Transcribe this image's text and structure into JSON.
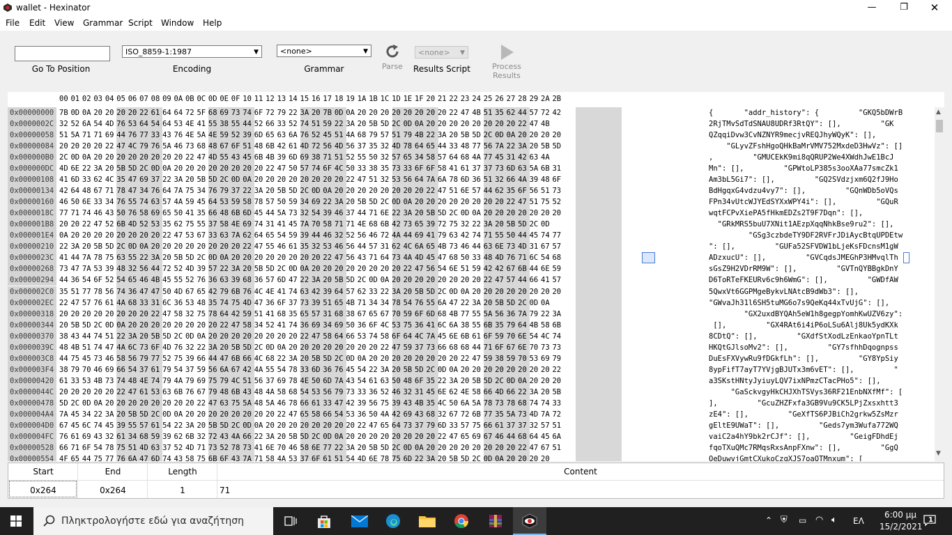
{
  "window": {
    "title": "wallet - Hexinator",
    "controls": {
      "minimize": "—",
      "maximize": "❐",
      "close": "✕"
    }
  },
  "menu": [
    "File",
    "Edit",
    "View",
    "Grammar",
    "Script",
    "Window",
    "Help"
  ],
  "toolbar": {
    "goto_value": "",
    "goto_label": "Go To Position",
    "encoding_value": "ISO_8859-1:1987",
    "encoding_label": "Encoding",
    "grammar_value": "<none>",
    "grammar_label": "Grammar",
    "parse_label": "Parse",
    "results_script_value": "<none>",
    "results_script_label": "Results Script",
    "process_results_label": "Process Results"
  },
  "hex_view": {
    "column_headers": [
      "00",
      "01",
      "02",
      "03",
      "04",
      "05",
      "06",
      "07",
      "08",
      "09",
      "0A",
      "0B",
      "0C",
      "0D",
      "0E",
      "0F",
      "10",
      "11",
      "12",
      "13",
      "14",
      "15",
      "16",
      "17",
      "18",
      "19",
      "1A",
      "1B",
      "1C",
      "1D",
      "1E",
      "1F",
      "20",
      "21",
      "22",
      "23",
      "24",
      "25",
      "26",
      "27",
      "28",
      "29",
      "2A",
      "2B"
    ],
    "selected": {
      "row": 13,
      "col": 40,
      "ascii_char": "q"
    },
    "rows": [
      {
        "offset": "0x00000000",
        "bytes": "7B 0D 0A 20 20 20 20 22 61 64 64 72 5F 68 69 73 74 6F 72 79 22 3A 20 7B 0D 0A 20 20 20 20 20 20 20 20 22 47 4B 51 35 62 44 57 72 42",
        "ascii": "{       \"addr_history\": {         \"GKQ5bDWrB"
      },
      {
        "offset": "0x0000002C",
        "bytes": "32 52 6A 54 4D 76 53 64 54 64 53 4E 41 55 38 55 44 52 66 33 52 74 51 59 22 3A 20 5B 5D 2C 0D 0A 20 20 20 20 20 20 20 20 22 47 4B",
        "ascii": "2RjTMvSdTdSNAU8UDRf3RtQY\": [],         \"GK"
      },
      {
        "offset": "0x00000058",
        "bytes": "51 5A 71 71 69 44 76 77 33 43 76 4E 5A 4E 59 52 39 6D 65 63 6A 76 52 45 51 4A 68 79 57 51 79 4B 22 3A 20 5B 5D 2C 0D 0A 20 20 20 20",
        "ascii": "QZqqiDvw3CvNZNYR9mecjvREQJhyWQyK\": [],"
      },
      {
        "offset": "0x00000084",
        "bytes": "20 20 20 20 22 47 4C 79 76 5A 46 73 68 48 67 6F 51 48 6B 42 61 4D 72 56 4D 56 37 35 32 4D 78 64 65 44 33 48 77 56 7A 22 3A 20 5B 5D",
        "ascii": "    \"GLyvZFshHgoQHkBaMrVMV752MxdeD3HwVz\": []"
      },
      {
        "offset": "0x000000B0",
        "bytes": "2C 0D 0A 20 20 20 20 20 20 20 20 22 47 4D 55 43 45 6B 4B 39 6D 69 38 71 51 52 55 50 32 57 65 34 58 57 64 68 4A 77 45 31 42 63 4A",
        "ascii": ",         \"GMUCEkK9mi8qQRUP2We4XWdhJwE1BcJ"
      },
      {
        "offset": "0x000000DC",
        "bytes": "4D 6E 22 3A 20 5B 5D 2C 0D 0A 20 20 20 20 20 20 20 20 22 47 50 57 74 6F 4C 50 33 38 35 73 33 6F 6F 58 41 61 37 37 73 6D 63 5A 6B 31",
        "ascii": "Mn\": [],         \"GPWtoLP385s3ooXAa77smcZk1"
      },
      {
        "offset": "0x00000108",
        "bytes": "41 6D 33 62 4C 35 47 69 37 22 3A 20 5B 5D 2C 0D 0A 20 20 20 20 20 20 20 20 22 47 51 32 53 56 64 7A 6A 78 6D 36 51 32 66 4A 39 48 6F",
        "ascii": "Am3bL5Gi7\": [],         \"GQ2SVdzjxm6Q2fJ9Ho"
      },
      {
        "offset": "0x00000134",
        "bytes": "42 64 48 67 71 78 47 34 76 64 7A 75 34 76 79 37 22 3A 20 5B 5D 2C 0D 0A 20 20 20 20 20 20 20 20 22 47 51 6E 57 44 62 35 6F 56 51 73",
        "ascii": "BdHgqxG4vdzu4vy7\": [],         \"GQnWDb5oVQs"
      },
      {
        "offset": "0x00000160",
        "bytes": "46 50 6E 33 34 76 55 74 63 57 4A 59 45 64 53 59 58 78 57 50 59 34 69 22 3A 20 5B 5D 2C 0D 0A 20 20 20 20 20 20 20 20 22 47 51 75 52",
        "ascii": "FPn34vUtcWJYEdSYXxWPY4i\": [],         \"GQuR"
      },
      {
        "offset": "0x0000018C",
        "bytes": "77 71 74 46 43 50 76 58 69 65 50 41 35 66 48 6B 6D 45 44 5A 73 32 54 39 46 37 44 71 6E 22 3A 20 5B 5D 2C 0D 0A 20 20 20 20 20 20 20",
        "ascii": "wqtFCPvXiePA5fHkmEDZs2T9F7Dqn\": [],"
      },
      {
        "offset": "0x000001B8",
        "bytes": "20 20 22 47 52 6B 4D 52 53 35 62 75 55 37 58 4E 69 74 31 41 45 7A 70 58 71 71 4E 68 6B 42 73 65 39 72 75 32 22 3A 20 5B 5D 2C 0D",
        "ascii": "  \"GRkMRS5buU7XNit1AEzpXqqNhkBse9ru2\": [],"
      },
      {
        "offset": "0x000001E4",
        "bytes": "0A 20 20 20 20 20 20 20 20 22 47 53 67 33 63 7A 62 64 65 54 59 39 44 46 32 52 56 46 72 4A 44 69 41 79 63 42 74 71 55 50 44 45 74 77",
        "ascii": "         \"GSg3czbdeTY9DF2RVFrJDiAycBtqUPDEtw"
      },
      {
        "offset": "0x00000210",
        "bytes": "22 3A 20 5B 5D 2C 0D 0A 20 20 20 20 20 20 20 20 22 47 55 46 61 35 32 53 46 56 44 57 31 62 4C 6A 65 4B 73 46 44 63 6E 73 4D 31 67 57",
        "ascii": "\": [],         \"GUFa52SFVDW1bLjeKsFDcnsM1gW"
      },
      {
        "offset": "0x0000023C",
        "bytes": "41 44 7A 78 75 63 55 22 3A 20 5B 5D 2C 0D 0A 20 20 20 20 20 20 20 20 22 47 56 43 71 64 73 4A 4D 45 47 68 50 33 48 4D 76 71 6C 54 68",
        "ascii": "ADzxucU\": [],         \"GVCqdsJMEGhP3HMvqlTh"
      },
      {
        "offset": "0x00000268",
        "bytes": "73 47 7A 53 39 48 32 56 44 72 52 4D 39 57 22 3A 20 5B 5D 2C 0D 0A 20 20 20 20 20 20 20 20 22 47 56 54 6E 51 59 42 42 67 6B 44 6E 59",
        "ascii": "sGsZ9H2VDrRM9W\": [],         \"GVTnQYBBgkDnY"
      },
      {
        "offset": "0x00000294",
        "bytes": "44 36 54 6F 52 54 65 46 4B 45 55 52 76 36 63 39 68 36 57 6D 47 22 3A 20 5B 5D 2C 0D 0A 20 20 20 20 20 20 20 20 22 47 57 44 66 41 57",
        "ascii": "D6ToRTeFKEURv6c9h6WmG\": [],         \"GWDfAW"
      },
      {
        "offset": "0x000002C0",
        "bytes": "35 51 77 78 56 74 36 47 47 50 4D 67 65 42 79 6B 76 4C 4E 41 74 63 42 39 64 57 62 33 22 3A 20 5B 5D 2C 0D 0A 20 20 20 20 20 20 20 20",
        "ascii": "5QwxVt6GGPMgeBykvLNAtcB9dWb3\": [],"
      },
      {
        "offset": "0x000002EC",
        "bytes": "22 47 57 76 61 4A 68 33 31 6C 36 53 48 35 74 75 4D 47 36 6F 37 73 39 51 65 4B 71 34 34 78 54 76 55 6A 47 22 3A 20 5B 5D 2C 0D 0A",
        "ascii": "\"GWvaJh31l6SH5tuMG6o7s9QeKq44xTvUjG\": [],"
      },
      {
        "offset": "0x00000318",
        "bytes": "20 20 20 20 20 20 20 20 22 47 58 32 75 78 64 42 59 51 41 68 35 65 57 31 68 38 67 65 67 70 59 6F 6D 68 4B 77 55 5A 56 36 7A 79 22 3A",
        "ascii": "        \"GX2uxdBYQAh5eW1h8gegpYomhKwUZV6zy\":"
      },
      {
        "offset": "0x00000344",
        "bytes": "20 5B 5D 2C 0D 0A 20 20 20 20 20 20 20 20 22 47 58 34 52 41 74 36 69 34 69 50 36 6F 4C 53 75 36 41 6C 6A 38 55 6B 35 79 64 4B 58 6B",
        "ascii": " [],         \"GX4RAt6i4iP6oLSu6Alj8Uk5ydKXk"
      },
      {
        "offset": "0x00000370",
        "bytes": "38 43 44 74 51 22 3A 20 5B 5D 2C 0D 0A 20 20 20 20 20 20 20 20 22 47 58 64 66 53 74 58 6F 64 4C 7A 45 6E 6B 61 6F 59 70 6E 54 4C 74",
        "ascii": "8CDtQ\": [],         \"GXdfStXodLzEnkaoYpnTLt"
      },
      {
        "offset": "0x0000039C",
        "bytes": "48 4B 51 74 47 4A 6C 73 6F 4D 76 32 22 3A 20 5B 5D 2C 0D 0A 20 20 20 20 20 20 20 20 22 47 59 37 73 66 68 68 44 71 6F 67 6E 70 73 73",
        "ascii": "HKQtGJlsoMv2\": [],         \"GY7sfhhDqognpss"
      },
      {
        "offset": "0x000003C8",
        "bytes": "44 75 45 73 46 58 56 79 77 52 75 39 66 44 47 6B 66 4C 68 22 3A 20 5B 5D 2C 0D 0A 20 20 20 20 20 20 20 20 22 47 59 38 59 70 53 69 79",
        "ascii": "DuEsFXVywRu9fDGkfLh\": [],         \"GY8YpSiy"
      },
      {
        "offset": "0x000003F4",
        "bytes": "38 79 70 46 69 66 54 37 61 79 54 37 59 56 6A 67 42 4A 55 54 78 33 6D 36 76 45 54 22 3A 20 5B 5D 2C 0D 0A 20 20 20 20 20 20 20 20 22",
        "ascii": "8ypFifT7ayT7YVjgBJUTx3m6vET\": [],         \""
      },
      {
        "offset": "0x00000420",
        "bytes": "61 33 53 4B 73 74 48 4E 74 79 4A 79 69 75 79 4C 51 56 37 69 78 4E 50 6D 7A 43 54 61 63 50 48 6F 35 22 3A 20 5B 5D 2C 0D 0A 20 20 20",
        "ascii": "a3SKstHNtyJyiuyLQV7ixNPmzCTacPHo5\": [],"
      },
      {
        "offset": "0x0000044C",
        "bytes": "20 20 20 20 20 22 47 61 53 63 6B 76 67 79 48 6B 43 48 4A 58 68 54 53 56 79 73 33 36 52 46 32 31 45 6E 62 4E 58 66 4D 66 22 3A 20 5B",
        "ascii": "     \"GaSckvgyHkCHJXhTSVys36RF21EnbNXfMf\": ["
      },
      {
        "offset": "0x00000478",
        "bytes": "5D 2C 0D 0A 20 20 20 20 20 20 20 20 22 47 63 75 5A 48 5A 46 78 66 61 33 47 42 39 56 75 39 43 4B 35 4C 50 6A 5A 78 73 78 68 74 74 33",
        "ascii": "],         \"GcuZHZFxfa3GB9Vu9CK5LPjZxsxhtt3"
      },
      {
        "offset": "0x000004A4",
        "bytes": "7A 45 34 22 3A 20 5B 5D 2C 0D 0A 20 20 20 20 20 20 20 20 22 47 65 58 66 54 53 36 50 4A 42 69 43 68 32 67 72 6B 77 35 5A 73 4D 7A 72",
        "ascii": "zE4\": [],         \"GeXfTS6PJBiCh2grkw5ZsMzr"
      },
      {
        "offset": "0x000004D0",
        "bytes": "67 45 6C 74 45 39 55 57 61 54 22 3A 20 5B 5D 2C 0D 0A 20 20 20 20 20 20 20 20 22 47 65 64 73 37 79 6D 33 57 75 66 61 37 37 32 57 51",
        "ascii": "gEltE9UWaT\": [],         \"Geds7ym3Wufa772WQ"
      },
      {
        "offset": "0x000004FC",
        "bytes": "76 61 69 43 32 61 34 68 59 39 62 6B 32 72 43 4A 66 22 3A 20 5B 5D 2C 0D 0A 20 20 20 20 20 20 20 20 22 47 65 69 67 46 44 68 64 45 6A",
        "ascii": "vaiC2a4hY9bk2rCJf\": [],         \"GeigFDhdEj"
      },
      {
        "offset": "0x00000528",
        "bytes": "66 71 6F 54 78 75 51 4D 63 37 52 4D 71 73 52 78 73 41 6E 70 46 58 6E 77 22 3A 20 5B 5D 2C 0D 0A 20 20 20 20 20 20 20 20 22 47 67 51",
        "ascii": "fqoTXuQMc7RMqsRxsAnpFXnw\": [],         \"GgQ"
      },
      {
        "offset": "0x00000554",
        "bytes": "4F 65 44 75 77 76 6A 47 6D 74 43 58 75 6B 6F 43 7A 71 58 4A 53 37 6F 61 51 54 4D 6E 78 75 6D 22 3A 20 5B 5D 2C 0D 0A 20 20 20 20",
        "ascii": "OeDuwvjGmtCXukoCzqXJS7oaQTMnxum\": ["
      }
    ]
  },
  "results": {
    "headers": {
      "start": "Start",
      "end": "End",
      "length": "Length",
      "content": "Content"
    },
    "row": {
      "start": "0x264",
      "end": "0x264",
      "length": "1",
      "content": "71"
    }
  },
  "taskbar": {
    "search_placeholder": "Πληκτρολογήστε εδώ για αναζήτηση",
    "language": "ΕΛ",
    "time": "6:00 μμ",
    "date": "15/2/2021",
    "notification_count": "1"
  }
}
